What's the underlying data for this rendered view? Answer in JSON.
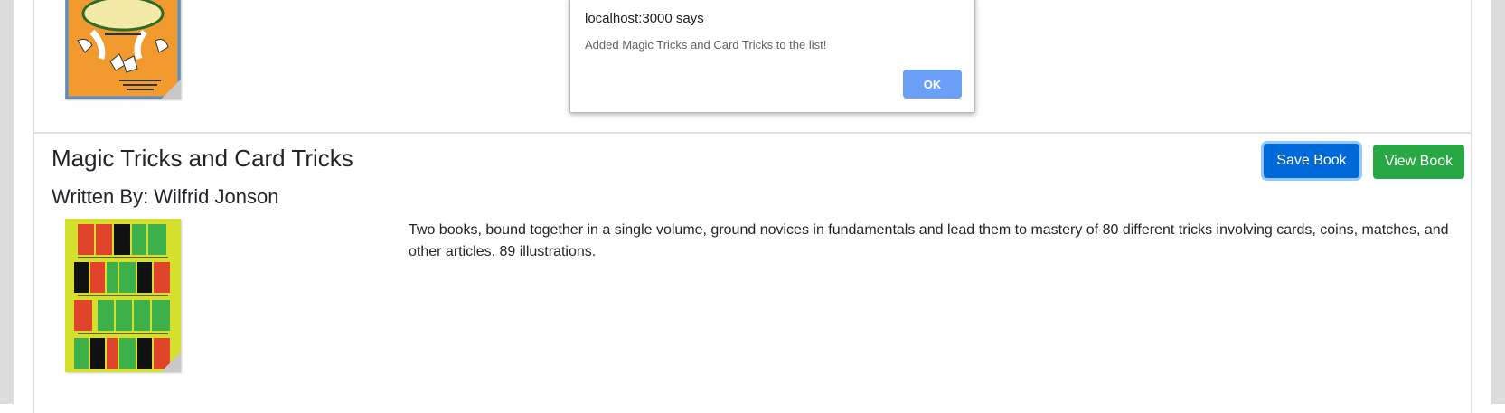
{
  "dialog": {
    "origin": "localhost:3000 says",
    "message": "Added Magic Tricks and Card Tricks to the list!",
    "ok_label": "OK",
    "ok_color": "#6b9ff7"
  },
  "previous_book": {
    "cover_icon": "book-cover-image",
    "cover_color": "#f29a2e"
  },
  "book": {
    "title": "Magic Tricks and Card Tricks",
    "author": "Written By: Wilfrid Jonson",
    "description": "Two books, bound together in a single volume, ground novices in fundamentals and lead them to mastery of 80 different tricks involving cards, coins, matches, and other articles. 89 illustrations.",
    "cover_icon": "book-cover-image",
    "cover_color": "#d4e02d",
    "save_label": "Save Book",
    "view_label": "View Book",
    "save_color": "#0069d9",
    "view_color": "#28a745"
  }
}
